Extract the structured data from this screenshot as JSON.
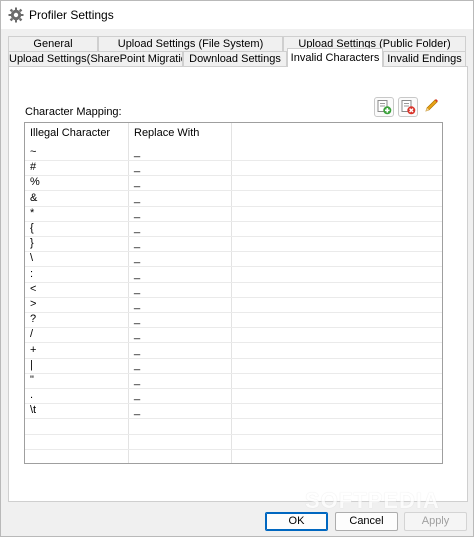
{
  "window": {
    "title": "Profiler Settings"
  },
  "tabs": {
    "row1": [
      {
        "label": "General"
      },
      {
        "label": "Upload Settings (File System)"
      },
      {
        "label": "Upload Settings (Public Folder)"
      }
    ],
    "row2": [
      {
        "label": "Upload Settings(SharePoint Migration)"
      },
      {
        "label": "Download Settings"
      },
      {
        "label": "Invalid Characters",
        "active": true
      },
      {
        "label": "Invalid Endings"
      }
    ]
  },
  "section": {
    "label": "Character Mapping:"
  },
  "toolbar": {
    "icons": [
      "add-icon",
      "delete-icon",
      "edit-icon"
    ]
  },
  "grid": {
    "columns": [
      "Illegal Character",
      "Replace With"
    ],
    "rows": [
      [
        "~",
        "_"
      ],
      [
        "#",
        "_"
      ],
      [
        "%",
        "_"
      ],
      [
        "&",
        "_"
      ],
      [
        "*",
        "_"
      ],
      [
        "{",
        "_"
      ],
      [
        "}",
        "_"
      ],
      [
        "\\",
        "_"
      ],
      [
        ":",
        "_"
      ],
      [
        "<",
        "_"
      ],
      [
        ">",
        "_"
      ],
      [
        "?",
        "_"
      ],
      [
        "/",
        "_"
      ],
      [
        "+",
        "_"
      ],
      [
        "|",
        "_"
      ],
      [
        "\"",
        "_"
      ],
      [
        ".",
        "_"
      ],
      [
        "\\t",
        "_"
      ]
    ]
  },
  "buttons": {
    "ok": "OK",
    "cancel": "Cancel",
    "apply": "Apply"
  },
  "watermark": "SOFTPEDIA",
  "colors": {
    "accent": "#0067c0",
    "add": "#3aa13a",
    "delete": "#d9342b",
    "edit": "#e8a317"
  }
}
